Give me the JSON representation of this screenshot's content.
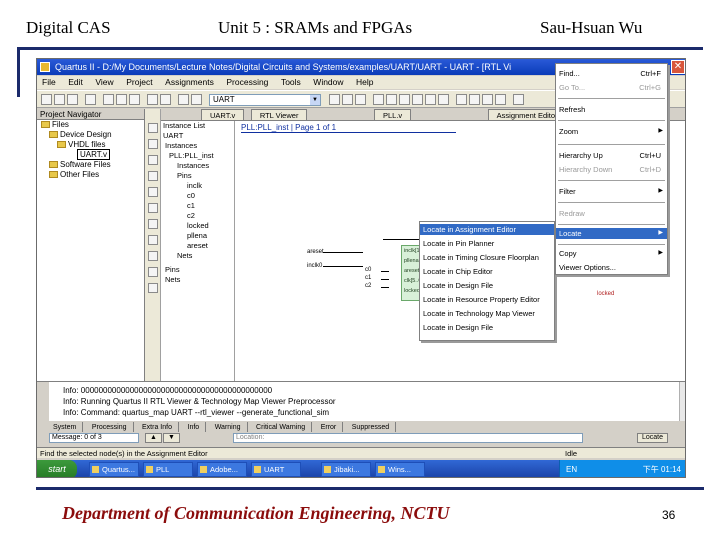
{
  "slide": {
    "header_left": "Digital CAS",
    "header_center": "Unit 5 : SRAMs and FPGAs",
    "header_right": "Sau-Hsuan Wu",
    "footer": "Department of Communication Engineering, NCTU",
    "page_number": "36"
  },
  "window": {
    "title": "Quartus II - D:/My Documents/Lecture Notes/Digital Circuits and Systems/examples/UART/UART - UART - [RTL Vi",
    "close_glyph": "✕"
  },
  "menubar": [
    "File",
    "Edit",
    "View",
    "Project",
    "Assignments",
    "Processing",
    "Tools",
    "Window",
    "Help"
  ],
  "toolbar": {
    "entity_combo": "UART",
    "combo_arrow": "▼"
  },
  "navigator": {
    "title": "Project Navigator",
    "items": [
      "Files",
      "Device Design",
      "VHDL files",
      "UART.v",
      "Software Files",
      "Other Files"
    ]
  },
  "hierarchy": {
    "items": [
      "Instance List",
      "UART",
      "Instances",
      "PLL:PLL_inst",
      "Instances",
      "Pins",
      "inclk",
      "c0",
      "c1",
      "c2",
      "locked",
      "pllena",
      "areset",
      "Nets",
      "Pins",
      "Nets"
    ]
  },
  "doc_tabs": [
    "UART.v",
    "RTL Viewer",
    "PLL.v",
    "Assignment Editor"
  ],
  "canvas": {
    "banner": "PLL:PLL_inst | Page 1 of 1",
    "pin_labels": [
      "areset",
      "inclk0",
      "pllena",
      "c0",
      "c1",
      "c2",
      "locked"
    ],
    "block_pins": [
      "inclk[1..0]",
      "pllena",
      "areset",
      "clk[5..0]",
      "locked"
    ]
  },
  "context_menu": {
    "items": [
      "Locate in Assignment Editor",
      "Locate in Pin Planner",
      "Locate in Timing Closure Floorplan",
      "Locate in Chip Editor",
      "Locate in Design File",
      "Locate in Resource Property Editor",
      "Locate in Technology Map Viewer",
      "Locate in Design File"
    ]
  },
  "main_menu": {
    "items": [
      {
        "label": "Find...",
        "shortcut": "Ctrl+F"
      },
      {
        "label": "Go To...",
        "shortcut": "Ctrl+G"
      },
      {
        "label": "Refresh",
        "shortcut": ""
      },
      {
        "label": "Zoom",
        "shortcut": "▶"
      },
      {
        "label": "Hierarchy Up",
        "shortcut": "Ctrl+U"
      },
      {
        "label": "Hierarchy Down",
        "shortcut": "Ctrl+D"
      },
      {
        "label": "Filter",
        "shortcut": "▶"
      },
      {
        "label": "Redraw",
        "shortcut": ""
      },
      {
        "label": "Locate",
        "shortcut": "▶"
      },
      {
        "label": "Copy",
        "shortcut": "▶"
      },
      {
        "label": "Viewer Options...",
        "shortcut": ""
      }
    ]
  },
  "messages": {
    "lines": [
      "Info: 0000000000000000000000000000000000000000000",
      "Info: Running Quartus II RTL Viewer & Technology Map Viewer Preprocessor",
      "Info: Command: quartus_map UART --rtl_viewer --generate_functional_sim"
    ],
    "tabs": [
      "System",
      "Processing",
      "Extra Info",
      "Info",
      "Warning",
      "Critical Warning",
      "Error",
      "Suppressed"
    ],
    "message_label": "Message: 0 of 3",
    "location_placeholder": "Location:",
    "locate_button": "Locate"
  },
  "status": {
    "text": "Find the selected node(s) in the Assignment Editor",
    "idle": "Idle"
  },
  "taskbar": {
    "start": "start",
    "buttons": [
      "Quartus...",
      "PLL",
      "Adobe...",
      "UART",
      "Jibaki...",
      "Wins..."
    ],
    "ime": "EN",
    "clock": "下午 01:14"
  },
  "colors": {
    "rule": "#1b2a6b",
    "footer": "#8b0c0c",
    "selection": "#316ac5"
  }
}
